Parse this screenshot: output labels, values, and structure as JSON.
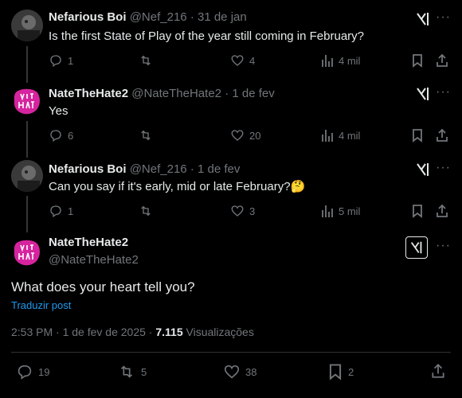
{
  "tweets": [
    {
      "name": "Nefarious Boi",
      "handle": "@Nef_216",
      "dot": "·",
      "date": "31 de jan",
      "text": "Is the first State of Play of the year still coming in February?",
      "emoji": "",
      "replies": "1",
      "retweets": "",
      "likes": "4",
      "views": "4 mil"
    },
    {
      "name": "NateTheHate2",
      "handle": "@NateTheHate2",
      "dot": "·",
      "date": "1 de fev",
      "text": "Yes",
      "emoji": "",
      "replies": "6",
      "retweets": "",
      "likes": "20",
      "views": "4 mil"
    },
    {
      "name": "Nefarious Boi",
      "handle": "@Nef_216",
      "dot": "·",
      "date": "1 de fev",
      "text": "Can you say if it's early, mid or late February?",
      "emoji": "🤔",
      "replies": "1",
      "retweets": "",
      "likes": "3",
      "views": "5 mil"
    }
  ],
  "focus": {
    "name": "NateTheHate2",
    "handle": "@NateTheHate2",
    "text": "What does your heart tell you?",
    "translate": "Traduzir post",
    "time": "2:53 PM · 1 de fev de 2025 · ",
    "views_count": "7.115",
    "views_label": " Visualizações",
    "replies": "19",
    "retweets": "5",
    "likes": "38",
    "bookmarks": "2"
  },
  "colors": {
    "background": "#000000",
    "text": "#e7e9ea",
    "muted": "#71767b",
    "link": "#1d9bf0",
    "avatar_pink": "#d6249f"
  },
  "icons": [
    "reply-icon",
    "retweet-icon",
    "like-icon",
    "views-icon",
    "bookmark-icon",
    "share-icon",
    "grok-icon",
    "more-icon"
  ]
}
